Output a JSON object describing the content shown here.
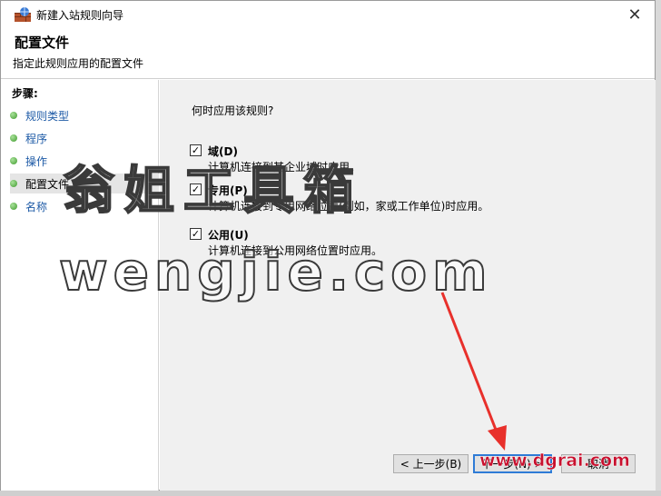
{
  "window": {
    "title": "新建入站规则向导",
    "close_glyph": "✕"
  },
  "header": {
    "title": "配置文件",
    "description": "指定此规则应用的配置文件"
  },
  "sidebar": {
    "steps_label": "步骤:",
    "items": [
      {
        "label": "规则类型"
      },
      {
        "label": "程序"
      },
      {
        "label": "操作"
      },
      {
        "label": "配置文件"
      },
      {
        "label": "名称"
      }
    ]
  },
  "main": {
    "question": "何时应用该规则?",
    "options": [
      {
        "label": "域(D)",
        "description": "计算机连接到其企业域时应用。",
        "checked": true
      },
      {
        "label": "专用(P)",
        "description": "计算机连接到专用网络位置(例如，家或工作单位)时应用。",
        "checked": true
      },
      {
        "label": "公用(U)",
        "description": "计算机连接到公用网络位置时应用。",
        "checked": true
      }
    ]
  },
  "buttons": {
    "back": "< 上一步(B)",
    "next": "下一步(N) >",
    "cancel": "取消"
  },
  "watermark": {
    "line1": "翁姐工具箱",
    "line2": "wengjie.com",
    "url": "www.dgrai.com"
  },
  "colors": {
    "accent": "#2f7bd6",
    "step_link": "#1d5aa6",
    "arrow": "#e8302b"
  },
  "icons": {
    "app": "firewall-icon",
    "close": "close-icon",
    "check": "checkmark-icon",
    "step": "green-dot-icon"
  }
}
